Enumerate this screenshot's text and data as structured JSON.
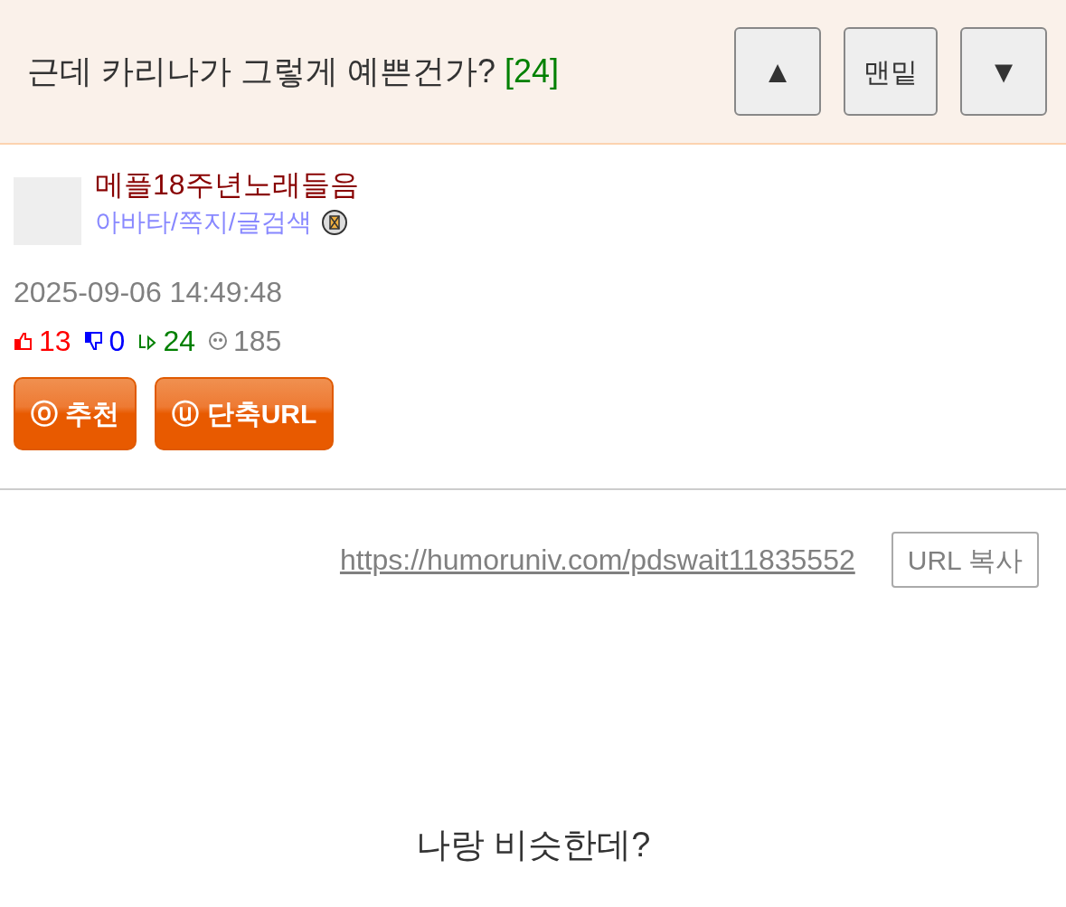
{
  "header": {
    "title": "근데 카리나가 그렇게 예쁜건가?",
    "comment_count": "[24]",
    "buttons": [
      {
        "kind": "up",
        "label": "▲"
      },
      {
        "kind": "bottom",
        "label": "맨밑"
      },
      {
        "kind": "down",
        "label": "▼"
      }
    ]
  },
  "author": {
    "name": "메플18주년노래들음",
    "links": "아바타/쪽지/글검색"
  },
  "date": "2025-09-06 14:49:48",
  "stats": [
    {
      "kind": "like",
      "value": "13",
      "color": "#ff0000"
    },
    {
      "kind": "dislike",
      "value": "0",
      "color": "#0000ff"
    },
    {
      "kind": "reply",
      "value": "24",
      "color": "#008000"
    },
    {
      "kind": "views",
      "value": "185",
      "color": "#808080"
    }
  ],
  "actions": [
    {
      "icon": "ⓞ",
      "label": "추천"
    },
    {
      "icon": "ⓤ",
      "label": "단축URL"
    }
  ],
  "short_url": {
    "url": "https://humoruniv.com/pdswait11835552",
    "copy_button": "URL 복사"
  },
  "body": "나랑 비슷한데?"
}
